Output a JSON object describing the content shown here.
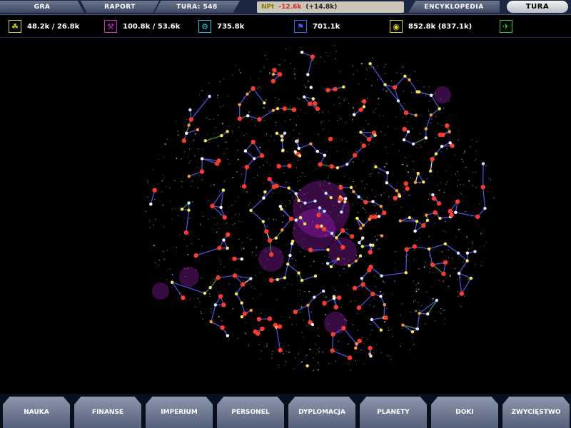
{
  "top_menu": {
    "gra": "GRA",
    "raport": "RAPORT",
    "tura_label": "TURA: 548",
    "income_icon": "NPt",
    "income_neg": "-12.6k",
    "income_pos": "(+14.8k)",
    "encyklopedia": "ENCYKLOPEDIA",
    "tura_button": "TURA"
  },
  "resources": [
    {
      "icon": "wheat-icon",
      "value": "48.2k / 26.8k",
      "color": "#d6d230"
    },
    {
      "icon": "industry-icon",
      "value": "100.8k / 53.6k",
      "color": "#d22ad0"
    },
    {
      "icon": "research-icon",
      "value": "735.8k",
      "color": "#18c8e6"
    },
    {
      "icon": "trade-icon",
      "value": "701.1k",
      "color": "#3a62ff"
    },
    {
      "icon": "influence-icon",
      "value": "852.8k (837.1k)",
      "color": "#d6d230"
    },
    {
      "icon": "fleet-icon",
      "value": "",
      "color": "#20d020"
    }
  ],
  "bottom_tabs": [
    "NAUKA",
    "FINANSE",
    "IMPERIUM",
    "PERSONEL",
    "DYPLOMACJA",
    "PLANETY",
    "DOKI",
    "ZWYCIĘSTWO"
  ]
}
